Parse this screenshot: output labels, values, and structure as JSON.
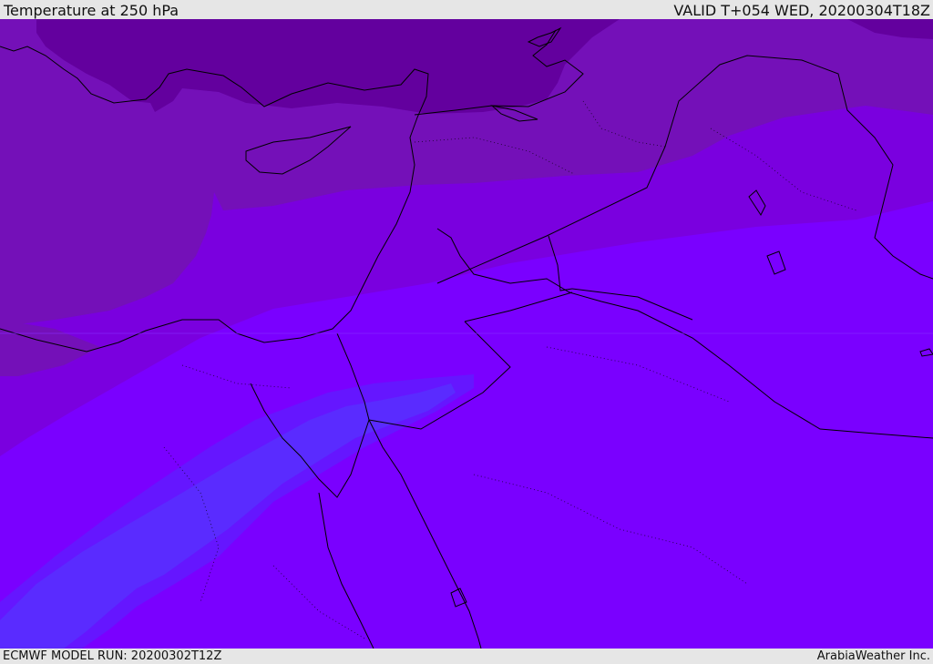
{
  "header": {
    "title": "Temperature at 250 hPa",
    "valid": "VALID T+054 WED, 20200304T18Z"
  },
  "footer": {
    "model_run": "ECMWF MODEL RUN: 20200302T12Z",
    "credit": "ArabiaWeather Inc."
  },
  "colors": {
    "band_darkest": "#63009e",
    "band_dark": "#7410b8",
    "band_mid": "#7a00df",
    "band_base": "#7a00ff",
    "band_cold_core": "#6516ff",
    "band_coldest": "#5a2bff",
    "coastline": "#000000"
  }
}
